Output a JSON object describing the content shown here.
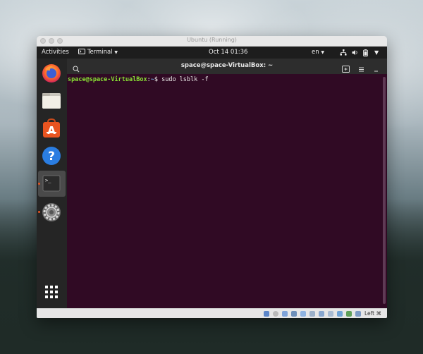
{
  "window": {
    "title": "Ubuntu (Running)"
  },
  "topbar": {
    "activities": "Activities",
    "app_menu": "Terminal",
    "clock": "Oct 14  01:36",
    "language": "en",
    "icons": [
      "network-icon",
      "volume-icon",
      "battery-icon",
      "system-menu-icon"
    ]
  },
  "dock": {
    "items": [
      {
        "name": "firefox",
        "running": false
      },
      {
        "name": "files",
        "running": false
      },
      {
        "name": "ubuntu-software",
        "running": false
      },
      {
        "name": "help",
        "running": false
      },
      {
        "name": "terminal",
        "running": true,
        "active": true
      },
      {
        "name": "settings",
        "running": true
      },
      {
        "name": "show-applications",
        "running": false
      }
    ]
  },
  "terminal": {
    "title": "space@space-VirtualBox: ~",
    "prompt_user": "space@space-VirtualBox",
    "prompt_sep": ":",
    "prompt_path": "~",
    "prompt_symbol": "$ ",
    "command": "sudo lsblk -f"
  },
  "statusbar": {
    "host_key": "Left ⌘"
  },
  "colors": {
    "terminal_bg": "#300a24",
    "prompt_user": "#8ae234",
    "prompt_path": "#729fcf",
    "ubuntu_orange": "#e95420"
  }
}
